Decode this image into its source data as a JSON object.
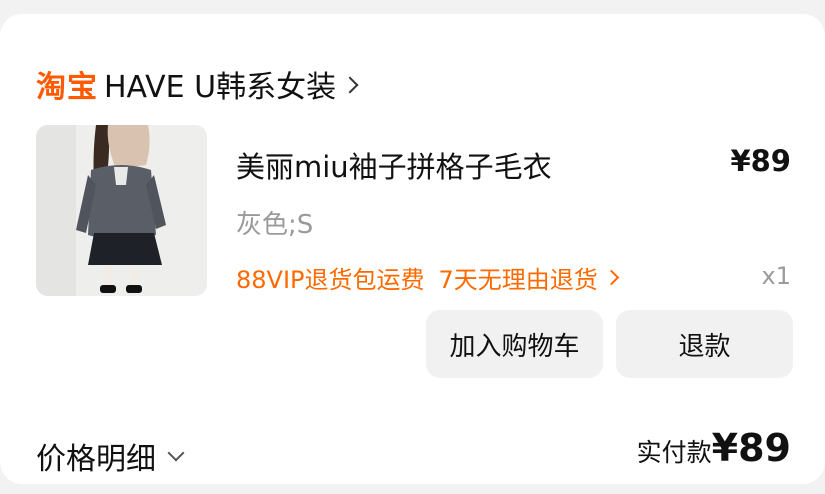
{
  "shop": {
    "brand": "淘宝",
    "name": "HAVE U韩系女装"
  },
  "item": {
    "title": "美丽miu袖子拼格子毛衣",
    "price": "¥89",
    "spec": "灰色;S",
    "services": [
      "88VIP退货包运费",
      "7天无理由退货"
    ],
    "quantity": "x1"
  },
  "actions": {
    "add_to_cart": "加入购物车",
    "refund": "退款"
  },
  "summary": {
    "detail_label": "价格明细",
    "paid_label": "实付款",
    "paid_amount": "¥89"
  },
  "colors": {
    "brand_orange": "#ff5a00",
    "service_orange": "#ff6a00",
    "muted_gray": "#9a9a9a",
    "button_bg": "#f1f1f1"
  }
}
